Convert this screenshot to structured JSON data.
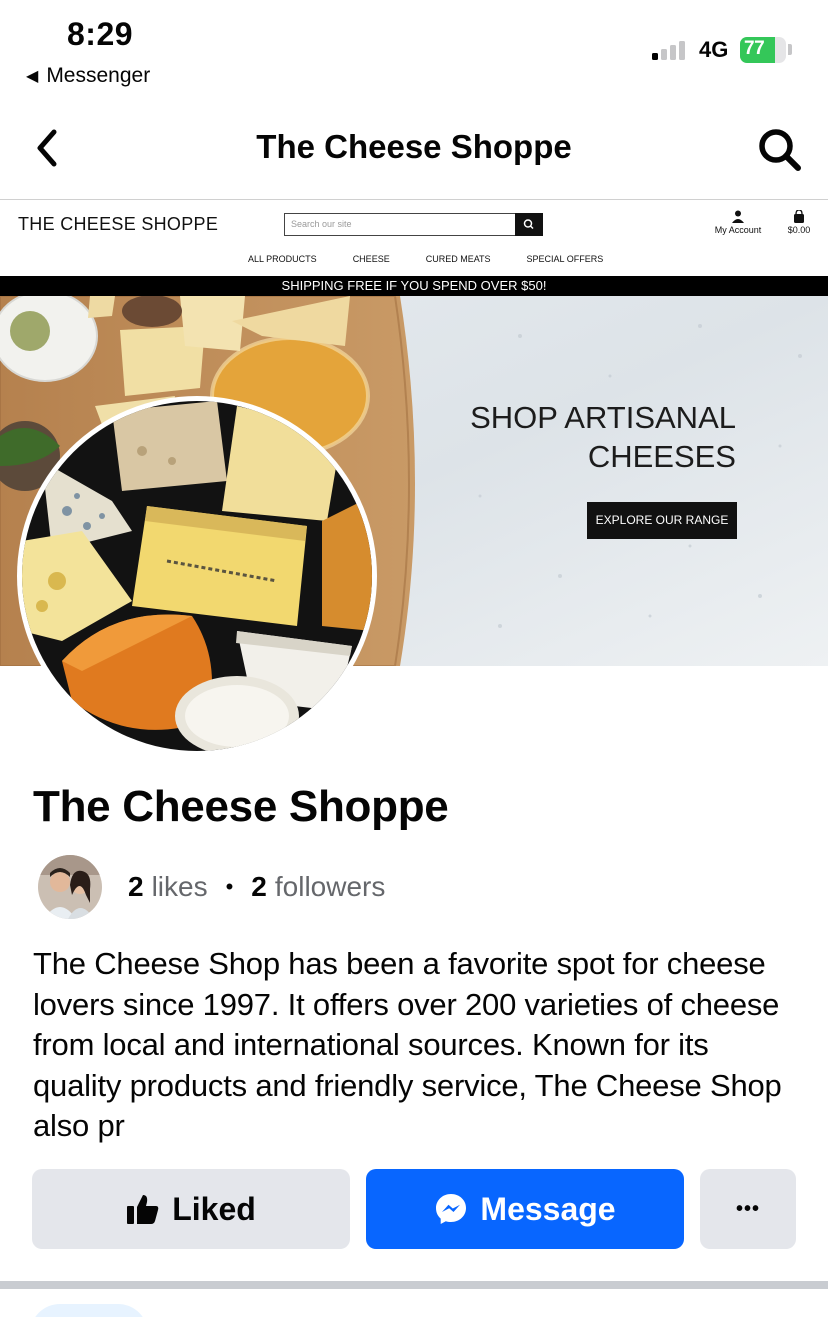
{
  "status_bar": {
    "time": "8:29",
    "back_app": "Messenger",
    "network": "4G",
    "battery_level": "77",
    "battery_fraction": 0.77
  },
  "header": {
    "title": "The Cheese Shoppe",
    "back_icon": "chevron-left-icon",
    "search_icon": "search-icon"
  },
  "cover": {
    "site_logo": "THE CHEESE SHOPPE",
    "search_placeholder": "Search our site",
    "account_label": "My Account",
    "cart_total": "$0.00",
    "nav": [
      "ALL PRODUCTS",
      "CHEESE",
      "CURED MEATS",
      "SPECIAL OFFERS"
    ],
    "shipping_banner": "SHIPPING FREE IF YOU SPEND OVER $50!",
    "hero_title_line1": "SHOP ARTISANAL",
    "hero_title_line2": "CHEESES",
    "hero_button": "EXPLORE OUR RANGE"
  },
  "page": {
    "name": "The Cheese Shoppe",
    "likes_count": "2",
    "likes_label": "likes",
    "separator": "•",
    "followers_count": "2",
    "followers_label": "followers",
    "about": "The Cheese Shop has been a favorite spot for cheese lovers since 1997. It offers over 200 varieties of cheese from local and international sources. Known for its quality products and friendly service, The Cheese Shop also pr"
  },
  "actions": {
    "liked": "Liked",
    "message": "Message",
    "more": "•••"
  },
  "colors": {
    "accent": "#0866ff",
    "button_gray": "#e4e6eb",
    "battery_green": "#34c759"
  }
}
